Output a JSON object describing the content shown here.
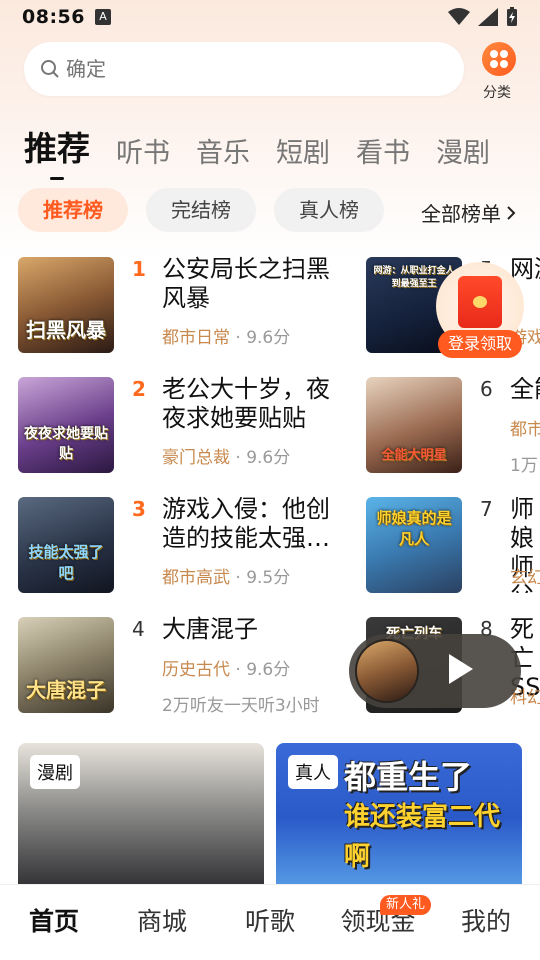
{
  "status": {
    "time": "08:56",
    "a_badge": "A"
  },
  "search": {
    "placeholder": "确定"
  },
  "category": {
    "label": "分类"
  },
  "tabs": [
    {
      "label": "推荐"
    },
    {
      "label": "听书"
    },
    {
      "label": "音乐"
    },
    {
      "label": "短剧"
    },
    {
      "label": "看书"
    },
    {
      "label": "漫剧"
    }
  ],
  "chips": [
    {
      "label": "推荐榜"
    },
    {
      "label": "完结榜"
    },
    {
      "label": "真人榜"
    }
  ],
  "all_ranks": "全部榜单",
  "books_left": [
    {
      "rank": "1",
      "title": "公安局长之扫黑风暴",
      "genre": "都市日常",
      "score": " · 9.6分",
      "cover_text": "扫黑风暴"
    },
    {
      "rank": "2",
      "title": "老公大十岁，夜夜求她要贴贴",
      "genre": "豪门总裁",
      "score": " · 9.6分",
      "cover_text": "夜夜求她要贴贴"
    },
    {
      "rank": "3",
      "title": "游戏入侵：他创造的技能太强…",
      "genre": "都市高武",
      "score": " · 9.5分",
      "cover_text": "技能太强了吧"
    },
    {
      "rank": "4",
      "title": "大唐混子",
      "genre": "历史古代",
      "score": " · 9.6分",
      "extra": "2万听友一天听3小时",
      "cover_text": "大唐混子"
    }
  ],
  "books_right": [
    {
      "rank": "5",
      "title": "网游",
      "meta": "游戏",
      "cover_text": "网游：从职业打金人到最强至王"
    },
    {
      "rank": "6",
      "title": "全能",
      "meta": "都市",
      "extra": "1万",
      "cover_text": "全能大明星"
    },
    {
      "rank": "7",
      "title": "师娘师父",
      "meta": "玄幻",
      "cover_text": "师娘真的是凡人"
    },
    {
      "rank": "8",
      "title": "死亡SS",
      "meta": "科幻",
      "cover_text": "死亡列车"
    }
  ],
  "promo": {
    "label": "登录领取"
  },
  "banners": [
    {
      "tag": "漫剧"
    },
    {
      "tag": "真人",
      "title_line1": "都重生了",
      "title_line2": "谁还装富二代啊"
    }
  ],
  "bottom_nav": [
    {
      "label": "首页"
    },
    {
      "label": "商城"
    },
    {
      "label": "听歌"
    },
    {
      "label": "领现金",
      "badge": "新人礼"
    },
    {
      "label": "我的"
    }
  ],
  "colors": {
    "accent": "#ff5a1f",
    "genre": "#c8894e"
  }
}
